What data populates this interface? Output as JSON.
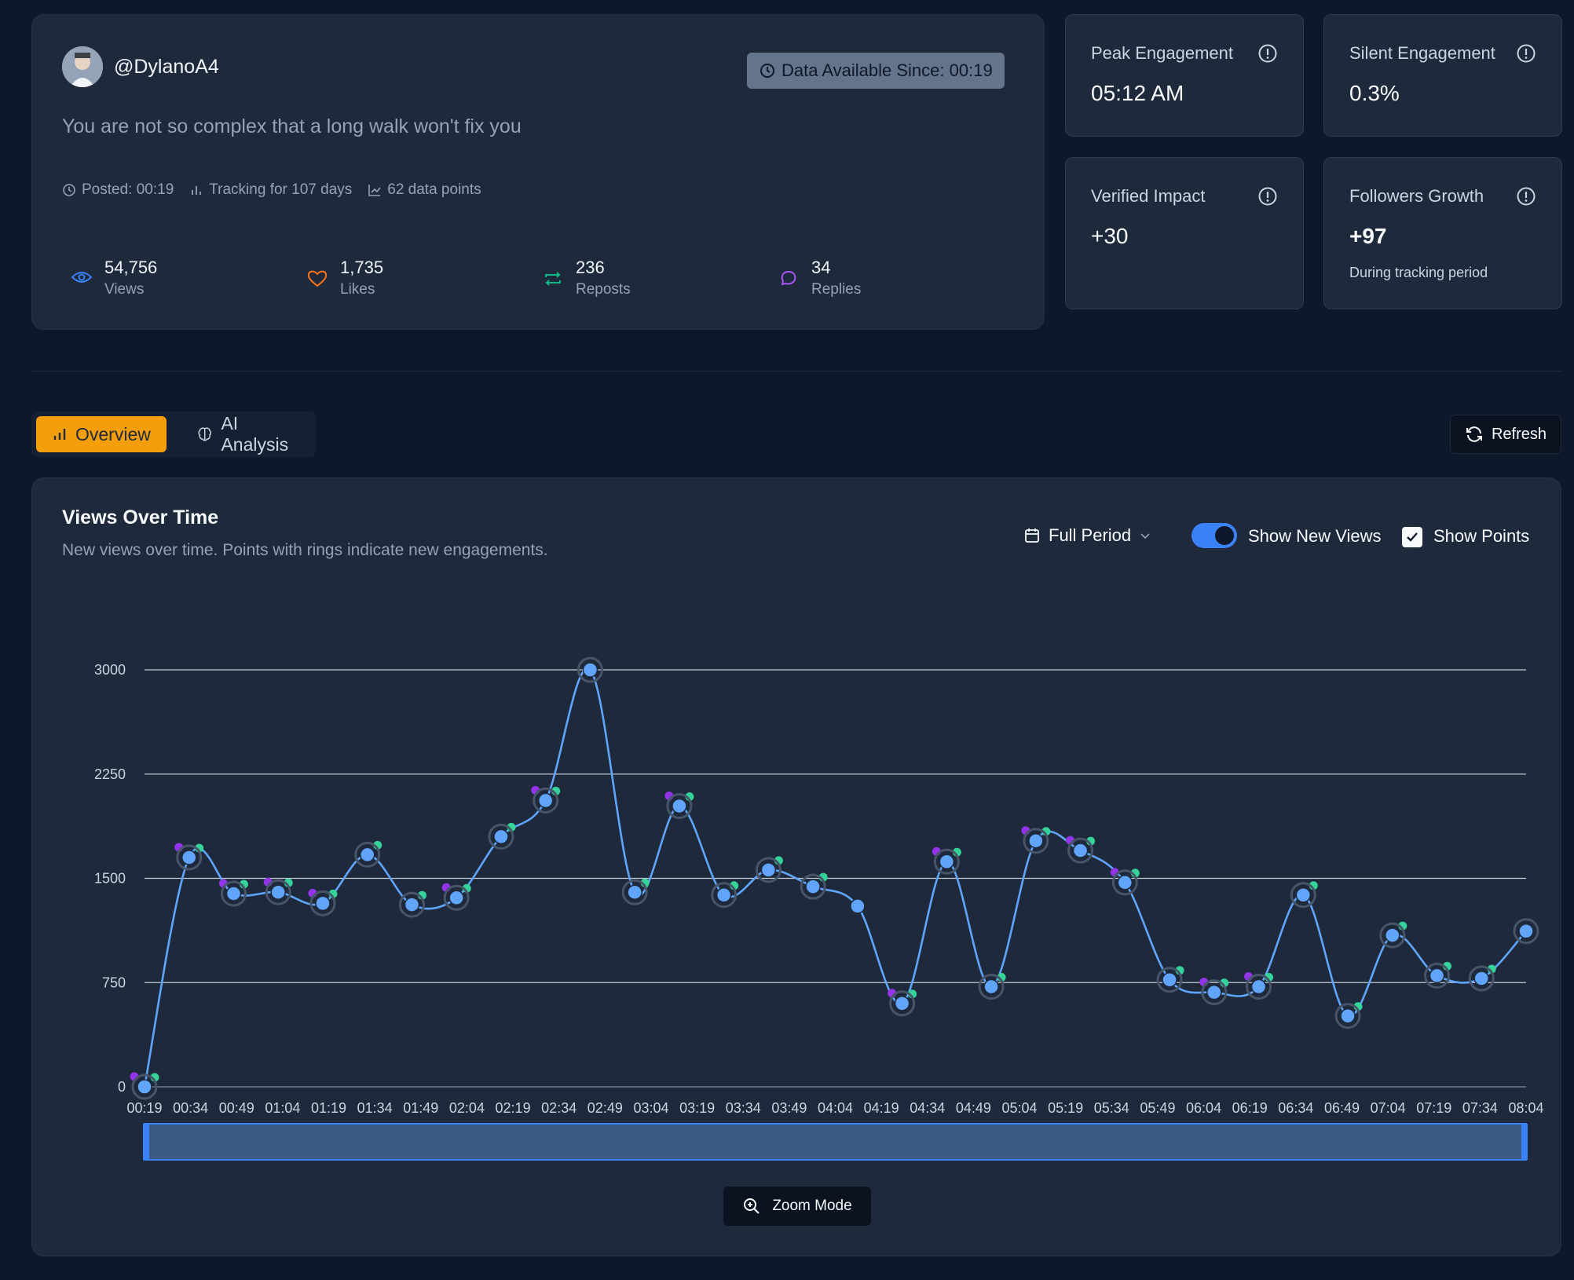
{
  "post": {
    "handle": "@DylanoA4",
    "text": "You are not so complex that a long walk won't fix you",
    "data_since": "Data Available Since: 00:19",
    "posted": "Posted: 00:19",
    "tracking": "Tracking for 107 days",
    "data_points": "62 data points",
    "stats": [
      {
        "value": "54,756",
        "label": "Views",
        "icon": "eye-icon",
        "color": "#3b82f6"
      },
      {
        "value": "1,735",
        "label": "Likes",
        "icon": "heart-icon",
        "color": "#f97316"
      },
      {
        "value": "236",
        "label": "Reposts",
        "icon": "repost-icon",
        "color": "#10b981"
      },
      {
        "value": "34",
        "label": "Replies",
        "icon": "reply-icon",
        "color": "#a855f7"
      }
    ]
  },
  "metrics": {
    "peak": {
      "label": "Peak Engagement",
      "value": "05:12 AM"
    },
    "silent": {
      "label": "Silent Engagement",
      "value": "0.3%"
    },
    "verified": {
      "label": "Verified Impact",
      "value": "+30"
    },
    "followers": {
      "label": "Followers Growth",
      "value": "+97",
      "sub": "During tracking period"
    }
  },
  "tabs": {
    "overview": "Overview",
    "ai": "AI Analysis"
  },
  "refresh_label": "Refresh",
  "chart_panel": {
    "title": "Views Over Time",
    "subtitle": "New views over time. Points with rings indicate new engagements.",
    "period": "Full Period",
    "toggle_label": "Show New Views",
    "checkbox_label": "Show Points",
    "zoom_label": "Zoom Mode"
  },
  "colors": {
    "line": "#60a5fa",
    "grid": "#e2e8f0",
    "purple": "#9333ea",
    "green": "#34d399",
    "accent": "#f59e0b"
  },
  "chart_data": {
    "type": "line",
    "title": "",
    "xlabel": "",
    "ylabel": "",
    "ylim": [
      0,
      3000
    ],
    "yticks": [
      0,
      750,
      1500,
      2250,
      3000
    ],
    "xticks": [
      "00:19",
      "00:34",
      "00:49",
      "01:04",
      "01:19",
      "01:34",
      "01:49",
      "02:04",
      "02:19",
      "02:34",
      "02:49",
      "03:04",
      "03:19",
      "03:34",
      "03:49",
      "04:04",
      "04:19",
      "04:34",
      "04:49",
      "05:04",
      "05:19",
      "05:34",
      "05:49",
      "06:04",
      "06:19",
      "06:34",
      "06:49",
      "07:04",
      "07:19",
      "07:34",
      "08:04"
    ],
    "series": [
      {
        "values": [
          0,
          1650,
          1390,
          1400,
          1320,
          1670,
          1310,
          1360,
          1800,
          2060,
          3000,
          1400,
          2020,
          1380,
          1560,
          1440,
          1300,
          600,
          1620,
          720,
          1770,
          1700,
          1470,
          770,
          680,
          720,
          1380,
          510,
          1090,
          800,
          780,
          1120
        ]
      }
    ],
    "engagement_indices": [
      0,
      1,
      2,
      3,
      4,
      5,
      6,
      7,
      8,
      9,
      10,
      11,
      12,
      13,
      14,
      15,
      17,
      18,
      19,
      20,
      21,
      22,
      23,
      24,
      25,
      26,
      27,
      28,
      29,
      30,
      31
    ],
    "purple_markers": [
      0,
      1,
      2,
      3,
      4,
      7,
      9,
      12,
      17,
      18,
      20,
      21,
      22,
      24,
      25
    ],
    "green_markers": [
      0,
      1,
      2,
      3,
      4,
      5,
      6,
      7,
      8,
      9,
      11,
      12,
      13,
      14,
      15,
      17,
      18,
      19,
      20,
      21,
      22,
      23,
      24,
      25,
      26,
      27,
      28,
      29,
      30
    ]
  }
}
